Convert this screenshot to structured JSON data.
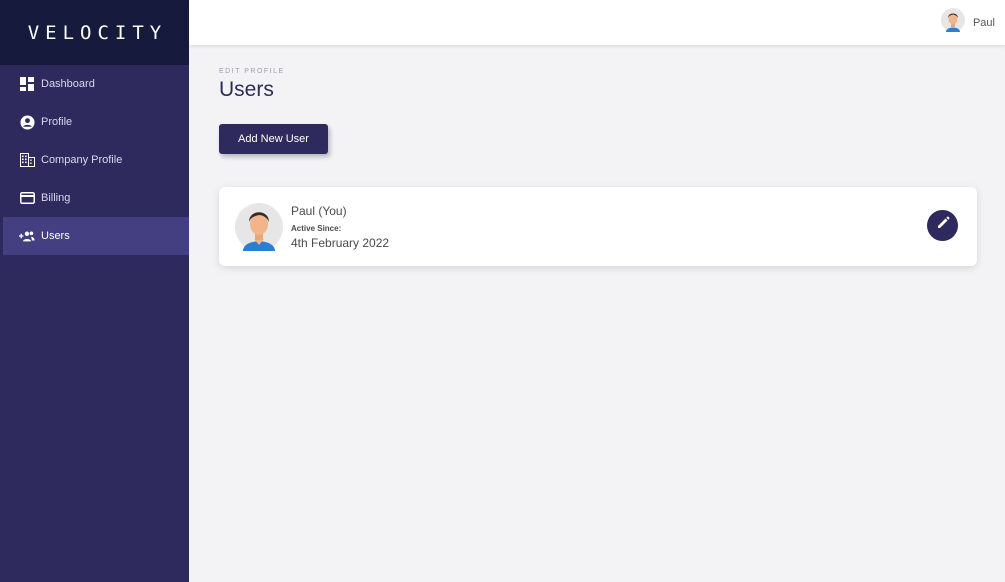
{
  "brand": {
    "name": "VELOCITY"
  },
  "sidebar": {
    "items": [
      {
        "label": "Dashboard",
        "icon": "dashboard-icon"
      },
      {
        "label": "Profile",
        "icon": "profile-icon"
      },
      {
        "label": "Company Profile",
        "icon": "building-icon"
      },
      {
        "label": "Billing",
        "icon": "credit-card-icon"
      },
      {
        "label": "Users",
        "icon": "users-add-icon",
        "active": true
      }
    ]
  },
  "header": {
    "user_name": "Paul"
  },
  "main": {
    "eyebrow": "EDIT PROFILE",
    "title": "Users",
    "add_button_label": "Add New User",
    "users": [
      {
        "name": "Paul (You)",
        "active_since_label": "Active Since:",
        "active_since": "4th February 2022"
      }
    ]
  },
  "colors": {
    "sidebar": "#2e2a5e",
    "brand_bg": "#161a3c",
    "active_item": "#433f80",
    "accent": "#2e2a5e"
  }
}
